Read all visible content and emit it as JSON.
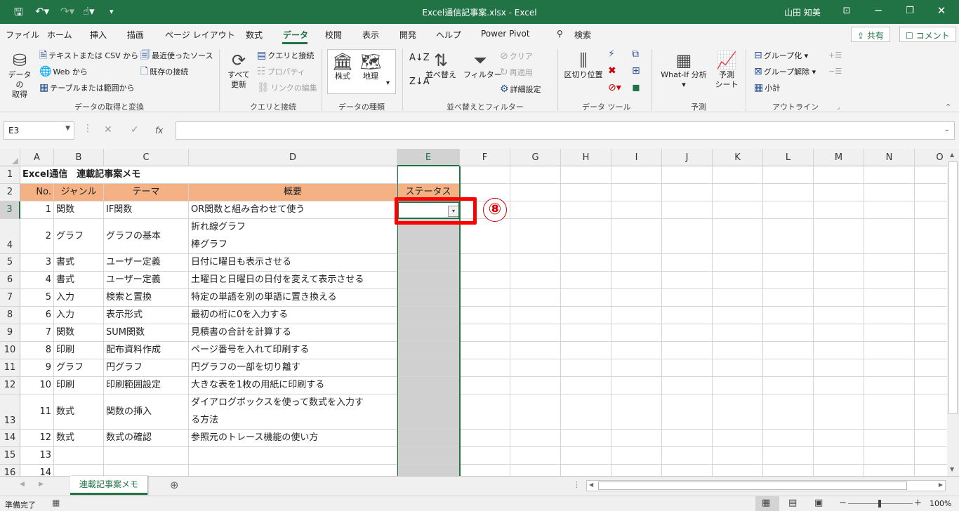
{
  "title_bar": {
    "filename": "Excel通信記事案.xlsx  -  Excel",
    "user": "山田 知美"
  },
  "menu": {
    "tabs": [
      "ファイル",
      "ホーム",
      "挿入",
      "描画",
      "ページ レイアウト",
      "数式",
      "データ",
      "校閲",
      "表示",
      "開発",
      "ヘルプ",
      "Power Pivot"
    ],
    "active_tab": "データ",
    "search": "検索",
    "share": "共有",
    "comment": "コメント"
  },
  "ribbon": {
    "get_data": "データの\n取得",
    "text_csv": "テキストまたは CSV から",
    "web": "Web から",
    "table_range": "テーブルまたは範囲から",
    "recent_sources": "最近使ったソース",
    "existing_conn": "既存の接続",
    "group_get": "データの取得と変換",
    "refresh_all": "すべて\n更新",
    "queries_conn": "クエリと接続",
    "properties": "プロパティ",
    "edit_links": "リンクの編集",
    "group_queries": "クエリと接続",
    "stocks": "株式",
    "geography": "地理",
    "group_types": "データの種類",
    "sort": "並べ替え",
    "filter": "フィルター",
    "clear": "クリア",
    "reapply": "再適用",
    "advanced": "詳細設定",
    "group_sort": "並べ替えとフィルター",
    "text_to_columns": "区切り位置",
    "group_tools": "データ ツール",
    "what_if": "What-If 分析",
    "forecast_sheet": "予測\nシート",
    "group_forecast": "予測",
    "group": "グループ化",
    "ungroup": "グループ解除",
    "subtotal": "小計",
    "group_outline": "アウトライン"
  },
  "formula_bar": {
    "name_box": "E3",
    "fx": "fx",
    "formula": ""
  },
  "columns": [
    "A",
    "B",
    "C",
    "D",
    "E",
    "F",
    "G",
    "H",
    "I",
    "J",
    "K",
    "L",
    "M",
    "N",
    "O"
  ],
  "sheet": {
    "title": "Excel通信　連載記事案メモ",
    "headers": [
      "No.",
      "ジャンル",
      "テーマ",
      "概要",
      "ステータス"
    ],
    "rows": [
      {
        "no": "1",
        "genre": "関数",
        "theme": "IF関数",
        "summary": [
          "OR関数と組み合わせて使う"
        ]
      },
      {
        "no": "2",
        "genre": "グラフ",
        "theme": "グラフの基本",
        "summary": [
          "折れ線グラフ",
          "棒グラフ"
        ]
      },
      {
        "no": "3",
        "genre": "書式",
        "theme": "ユーザー定義",
        "summary": [
          "日付に曜日も表示させる"
        ]
      },
      {
        "no": "4",
        "genre": "書式",
        "theme": "ユーザー定義",
        "summary": [
          "土曜日と日曜日の日付を変えて表示させる"
        ]
      },
      {
        "no": "5",
        "genre": "入力",
        "theme": "検索と置換",
        "summary": [
          "特定の単語を別の単語に置き換える"
        ]
      },
      {
        "no": "6",
        "genre": "入力",
        "theme": "表示形式",
        "summary": [
          "最初の桁に0を入力する"
        ]
      },
      {
        "no": "7",
        "genre": "関数",
        "theme": "SUM関数",
        "summary": [
          "見積書の合計を計算する"
        ]
      },
      {
        "no": "8",
        "genre": "印刷",
        "theme": "配布資料作成",
        "summary": [
          "ページ番号を入れて印刷する"
        ]
      },
      {
        "no": "9",
        "genre": "グラフ",
        "theme": "円グラフ",
        "summary": [
          "円グラフの一部を切り離す"
        ]
      },
      {
        "no": "10",
        "genre": "印刷",
        "theme": "印刷範囲設定",
        "summary": [
          "大きな表を1枚の用紙に印刷する"
        ]
      },
      {
        "no": "11",
        "genre": "数式",
        "theme": "関数の挿入",
        "summary": [
          "ダイアログボックスを使って数式を入力す",
          "る方法"
        ]
      },
      {
        "no": "12",
        "genre": "数式",
        "theme": "数式の確認",
        "summary": [
          "参照元のトレース機能の使い方"
        ]
      },
      {
        "no": "13",
        "genre": "",
        "theme": "",
        "summary": [
          ""
        ]
      },
      {
        "no": "14",
        "genre": "",
        "theme": "",
        "summary": [
          ""
        ]
      }
    ],
    "row_numbers": [
      "1",
      "2",
      "3",
      "4",
      "5",
      "6",
      "7",
      "8",
      "9",
      "10",
      "11",
      "12",
      "13",
      "14",
      "15",
      "16"
    ]
  },
  "annotation": {
    "step": "⑧",
    "color": "#ff0000"
  },
  "sheet_tab": "連載記事案メモ",
  "status": {
    "ready": "準備完了",
    "zoom": "100%"
  },
  "colors": {
    "excel_green": "#217346",
    "header_fill": "#f4b183",
    "selected_col": "#d0d0d0"
  }
}
